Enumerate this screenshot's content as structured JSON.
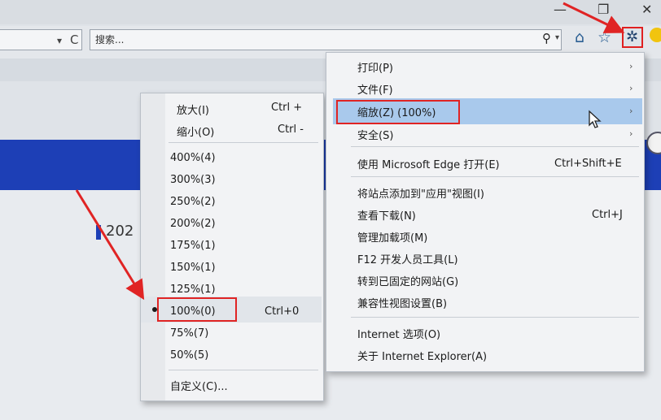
{
  "window": {
    "minimize_glyph": "—",
    "restore_glyph": "❐",
    "close_glyph": "✕"
  },
  "toolbar": {
    "address_dropdown_glyph": "▾",
    "refresh_glyph": "C",
    "search_placeholder": "搜索...",
    "search_glyph": "⚲",
    "search_dropdown_glyph": "▾",
    "home_glyph": "⌂",
    "favorites_glyph": "☆",
    "gear_glyph": "✲"
  },
  "page": {
    "visible_text": "202"
  },
  "tools_menu": {
    "items": [
      {
        "label": "打印(P)",
        "shortcut": "",
        "arrow": "›"
      },
      {
        "label": "文件(F)",
        "shortcut": "",
        "arrow": "›"
      },
      {
        "label": "缩放(Z) (100%)",
        "shortcut": "",
        "arrow": "›"
      },
      {
        "label": "安全(S)",
        "shortcut": "",
        "arrow": "›"
      },
      {
        "label": "使用 Microsoft Edge 打开(E)",
        "shortcut": "Ctrl+Shift+E",
        "arrow": ""
      },
      {
        "label": "将站点添加到\"应用\"视图(I)",
        "shortcut": "",
        "arrow": ""
      },
      {
        "label": "查看下载(N)",
        "shortcut": "Ctrl+J",
        "arrow": ""
      },
      {
        "label": "管理加载项(M)",
        "shortcut": "",
        "arrow": ""
      },
      {
        "label": "F12 开发人员工具(L)",
        "shortcut": "",
        "arrow": ""
      },
      {
        "label": "转到已固定的网站(G)",
        "shortcut": "",
        "arrow": ""
      },
      {
        "label": "兼容性视图设置(B)",
        "shortcut": "",
        "arrow": ""
      },
      {
        "label": "Internet 选项(O)",
        "shortcut": "",
        "arrow": ""
      },
      {
        "label": "关于 Internet Explorer(A)",
        "shortcut": "",
        "arrow": ""
      }
    ]
  },
  "zoom_menu": {
    "items": [
      {
        "label": "放大(I)",
        "shortcut": "Ctrl +"
      },
      {
        "label": "缩小(O)",
        "shortcut": "Ctrl -"
      },
      {
        "label": "400%(4)",
        "shortcut": ""
      },
      {
        "label": "300%(3)",
        "shortcut": ""
      },
      {
        "label": "250%(2)",
        "shortcut": ""
      },
      {
        "label": "200%(2)",
        "shortcut": ""
      },
      {
        "label": "175%(1)",
        "shortcut": ""
      },
      {
        "label": "150%(1)",
        "shortcut": ""
      },
      {
        "label": "125%(1)",
        "shortcut": ""
      },
      {
        "label": "100%(0)",
        "shortcut": "Ctrl+0",
        "selected": true
      },
      {
        "label": "75%(7)",
        "shortcut": ""
      },
      {
        "label": "50%(5)",
        "shortcut": ""
      },
      {
        "label": "自定义(C)...",
        "shortcut": ""
      }
    ]
  },
  "colors": {
    "menu_bg": "#f2f3f5",
    "highlight": "#a9c9ec",
    "annotation_red": "#e02424",
    "page_blue": "#1d3fb6"
  }
}
